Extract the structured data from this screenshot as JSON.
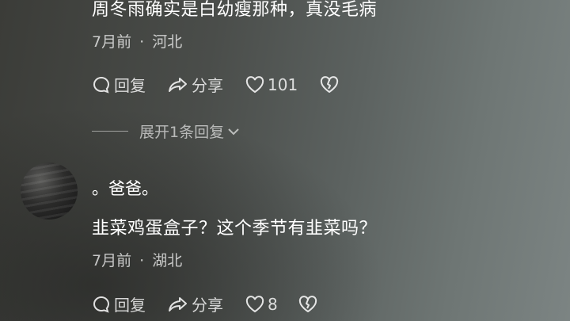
{
  "comment1": {
    "text": "周冬雨确实是白幼瘦那种，真没毛病",
    "time": "7月前",
    "sep": "·",
    "location": "河北",
    "reply_label": "回复",
    "share_label": "分享",
    "likes": "101"
  },
  "expand_replies": {
    "label": "展开1条回复"
  },
  "comment2": {
    "username": "。爸爸。",
    "text": "韭菜鸡蛋盒子？这个季节有韭菜吗？",
    "time": "7月前",
    "sep": "·",
    "location": "湖北",
    "reply_label": "回复",
    "share_label": "分享",
    "likes": "8"
  },
  "icons": {
    "reply": "speech-bubble-icon",
    "share": "share-arrow-icon",
    "like": "heart-icon",
    "dislike": "broken-heart-icon",
    "expand": "chevron-down-icon"
  }
}
